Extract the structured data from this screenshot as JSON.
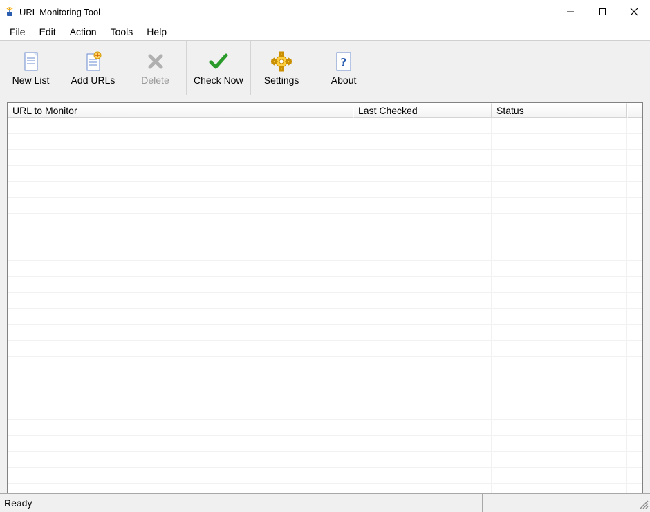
{
  "window": {
    "title": "URL Monitoring Tool"
  },
  "menubar": {
    "items": [
      "File",
      "Edit",
      "Action",
      "Tools",
      "Help"
    ]
  },
  "toolbar": {
    "buttons": [
      {
        "label": "New List",
        "icon": "new-list-icon",
        "enabled": true
      },
      {
        "label": "Add URLs",
        "icon": "add-urls-icon",
        "enabled": true
      },
      {
        "label": "Delete",
        "icon": "delete-icon",
        "enabled": false
      },
      {
        "label": "Check Now",
        "icon": "check-now-icon",
        "enabled": true
      },
      {
        "label": "Settings",
        "icon": "settings-icon",
        "enabled": true
      },
      {
        "label": "About",
        "icon": "about-icon",
        "enabled": true
      }
    ]
  },
  "list": {
    "columns": [
      "URL to Monitor",
      "Last Checked",
      "Status"
    ],
    "rows": []
  },
  "statusbar": {
    "text": "Ready"
  }
}
